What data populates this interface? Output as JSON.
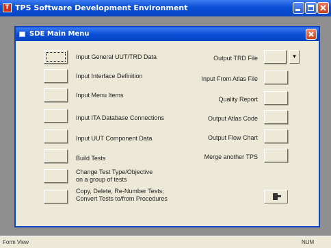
{
  "app": {
    "title": "TPS Software Development Environment",
    "icon": "app-icon"
  },
  "menu": {
    "title": "SDE Main Menu"
  },
  "left_items": [
    {
      "label_1": "Input General UUT/TRD Data",
      "label_2": ""
    },
    {
      "label_1": "Input Interface Definition",
      "label_2": ""
    },
    {
      "label_1": "Input Menu Items",
      "label_2": ""
    },
    {
      "label_1": "Input ITA Database Connections",
      "label_2": ""
    },
    {
      "label_1": "Input UUT Component Data",
      "label_2": ""
    },
    {
      "label_1": "Build Tests",
      "label_2": ""
    },
    {
      "label_1": "Change Test Type/Objective",
      "label_2": "on a group of tests"
    },
    {
      "label_1": "Copy, Delete, Re-Number Tests;",
      "label_2": "Convert Tests to/from Procedures"
    }
  ],
  "right_items": [
    {
      "label": "Output TRD File"
    },
    {
      "label": "Input From Atlas File"
    },
    {
      "label": "Quality Report"
    },
    {
      "label": "Output Atlas Code"
    },
    {
      "label": "Output Flow Chart"
    },
    {
      "label": "Merge another TPS"
    }
  ],
  "dropdown_glyph": "▾",
  "exit_icon": "exit-door-icon",
  "status": {
    "left": "Form View",
    "right": "NUM"
  }
}
